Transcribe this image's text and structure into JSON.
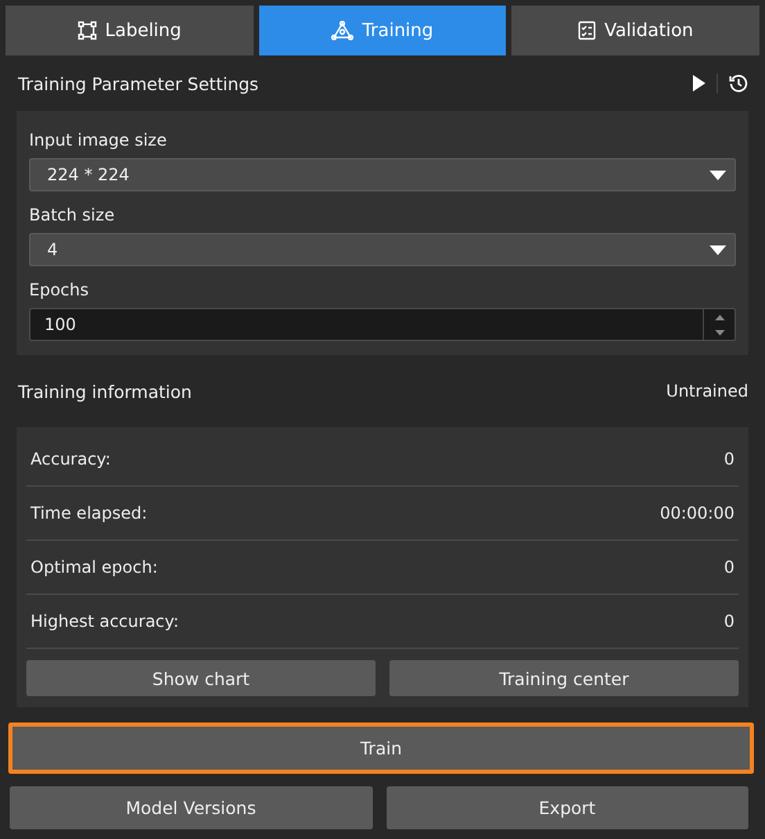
{
  "tabs": [
    {
      "label": "Labeling",
      "selected": false
    },
    {
      "label": "Training",
      "selected": true
    },
    {
      "label": "Validation",
      "selected": false
    }
  ],
  "parameters": {
    "title": "Training Parameter Settings",
    "fields": [
      {
        "kind": "dropdown",
        "label": "Input image size",
        "value": "224 * 224"
      },
      {
        "kind": "dropdown",
        "label": "Batch size",
        "value": "4"
      },
      {
        "kind": "spinbox",
        "label": "Epochs",
        "value": "100"
      }
    ]
  },
  "training_info": {
    "title": "Training information",
    "status": "Untrained",
    "rows": [
      {
        "label": "Accuracy:",
        "value": "0"
      },
      {
        "label": "Time elapsed:",
        "value": "00:00:00"
      },
      {
        "label": "Optimal epoch:",
        "value": "0"
      },
      {
        "label": "Highest accuracy:",
        "value": "0"
      }
    ],
    "buttons": [
      "Show chart",
      "Training center"
    ]
  },
  "train_button": {
    "label": "Train",
    "highlighted": true
  },
  "bottom_buttons": [
    "Model Versions",
    "Export"
  ]
}
